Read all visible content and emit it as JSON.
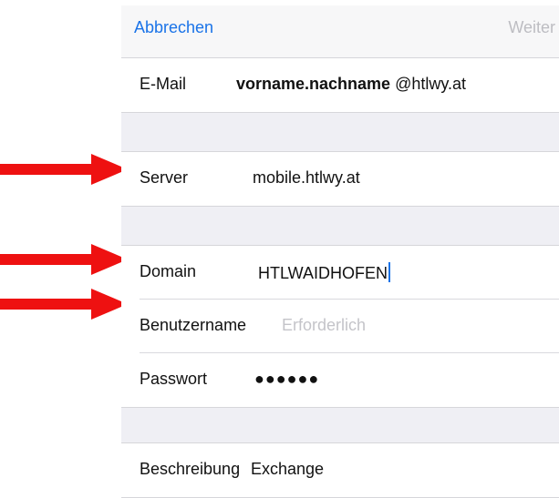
{
  "navbar": {
    "cancel": "Abbrechen",
    "next": "Weiter"
  },
  "rows": {
    "email": {
      "label": "E-Mail",
      "value_bold": "vorname.nachname",
      "value_suffix": " @htlwy.at"
    },
    "server": {
      "label": "Server",
      "value": "mobile.htlwy.at"
    },
    "domain": {
      "label": "Domain",
      "value": "HTLWAIDHOFEN"
    },
    "username": {
      "label": "Benutzername",
      "placeholder": "Erforderlich"
    },
    "password": {
      "label": "Passwort",
      "value": "●●●●●●"
    },
    "description": {
      "label": "Beschreibung",
      "value": "Exchange"
    }
  },
  "colors": {
    "accent": "#1a73e8",
    "arrow": "#ee1111",
    "separator": "#efeff4"
  },
  "icons": {
    "annotation": "red-arrow-icon"
  }
}
